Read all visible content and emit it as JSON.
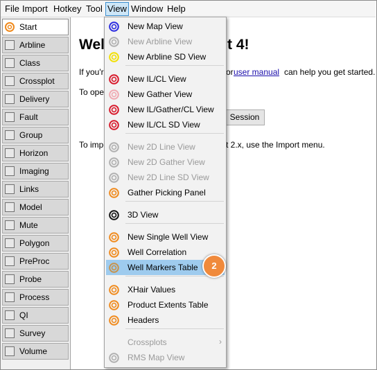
{
  "menubar": {
    "items": [
      "File",
      "Import",
      "Hotkey",
      "Tool",
      "View",
      "Window",
      "Help"
    ],
    "active": "View"
  },
  "sidebar": {
    "items": [
      {
        "label": "Start",
        "icon": "start-icon",
        "active": true
      },
      {
        "label": "Arbline",
        "icon": "arbline-icon"
      },
      {
        "label": "Class",
        "icon": "class-icon"
      },
      {
        "label": "Crossplot",
        "icon": "crossplot-icon"
      },
      {
        "label": "Delivery",
        "icon": "delivery-icon"
      },
      {
        "label": "Fault",
        "icon": "fault-icon"
      },
      {
        "label": "Group",
        "icon": "group-icon"
      },
      {
        "label": "Horizon",
        "icon": "horizon-icon"
      },
      {
        "label": "Imaging",
        "icon": "imaging-icon"
      },
      {
        "label": "Links",
        "icon": "links-icon"
      },
      {
        "label": "Model",
        "icon": "model-icon"
      },
      {
        "label": "Mute",
        "icon": "mute-icon"
      },
      {
        "label": "Polygon",
        "icon": "polygon-icon"
      },
      {
        "label": "PreProc",
        "icon": "preproc-icon"
      },
      {
        "label": "Probe",
        "icon": "probe-icon"
      },
      {
        "label": "Process",
        "icon": "process-icon"
      },
      {
        "label": "QI",
        "icon": "qi-icon"
      },
      {
        "label": "Survey",
        "icon": "survey-icon"
      },
      {
        "label": "Volume",
        "icon": "volume-icon"
      }
    ]
  },
  "main": {
    "title_left": "Wel",
    "title_right": "t 4!",
    "line1_left": "If you'r",
    "line1_mid": "or",
    "line1_link": "user manual",
    "line1_right": "can help you get started.",
    "line2_left": "To oper",
    "session_button": "Session",
    "line3_left": "To impo",
    "line3_right": "t 2.x, use the Import menu."
  },
  "view_menu": {
    "items": [
      {
        "label": "New Map View",
        "icon": "map-view-icon",
        "color": "#2a2ae0",
        "disabled": false
      },
      {
        "label": "New Arbline View",
        "icon": "arbline-view-icon",
        "color": "#b0b0b0",
        "disabled": true
      },
      {
        "label": "New Arbline SD View",
        "icon": "arbline-sd-view-icon",
        "color": "#f2e000",
        "disabled": false
      },
      {
        "label": "New IL/CL View",
        "icon": "il-cl-view-icon",
        "color": "#d8182a",
        "disabled": false
      },
      {
        "label": "New Gather View",
        "icon": "gather-view-icon",
        "color": "#f0a8b0",
        "disabled": false
      },
      {
        "label": "New IL/Gather/CL View",
        "icon": "il-gather-cl-view-icon",
        "color": "#d8182a",
        "disabled": false
      },
      {
        "label": "New IL/CL SD View",
        "icon": "il-cl-sd-view-icon",
        "color": "#d8182a",
        "disabled": false
      },
      {
        "label": "New 2D Line View",
        "icon": "2d-line-view-icon",
        "color": "#b0b0b0",
        "disabled": true
      },
      {
        "label": "New 2D Gather View",
        "icon": "2d-gather-view-icon",
        "color": "#b0b0b0",
        "disabled": true
      },
      {
        "label": "New 2D Line SD View",
        "icon": "2d-line-sd-view-icon",
        "color": "#b0b0b0",
        "disabled": true
      },
      {
        "label": "Gather Picking Panel",
        "icon": "gather-picking-icon",
        "color": "#f08a1c",
        "disabled": false
      },
      {
        "label": "3D View",
        "icon": "3d-view-icon",
        "color": "#111111",
        "disabled": false
      },
      {
        "label": "New Single Well View",
        "icon": "single-well-view-icon",
        "color": "#f08a1c",
        "disabled": false
      },
      {
        "label": "Well Correlation",
        "icon": "well-correlation-icon",
        "color": "#f08a1c",
        "disabled": false
      },
      {
        "label": "Well Markers Table",
        "icon": "well-markers-table-icon",
        "color": "#c8924a",
        "disabled": false,
        "highlighted": true
      },
      {
        "label": "XHair Values",
        "icon": "xhair-values-icon",
        "color": "#f08a1c",
        "disabled": false
      },
      {
        "label": "Product Extents Table",
        "icon": "product-extents-icon",
        "color": "#f08a1c",
        "disabled": false
      },
      {
        "label": "Headers",
        "icon": "headers-icon",
        "color": "#f08a1c",
        "disabled": false
      },
      {
        "label": "Crossplots",
        "icon": "",
        "color": "",
        "disabled": true,
        "submenu": true
      },
      {
        "label": "RMS Map View",
        "icon": "rms-map-view-icon",
        "color": "#b0b0b0",
        "disabled": true
      }
    ]
  },
  "step_badge": "2"
}
